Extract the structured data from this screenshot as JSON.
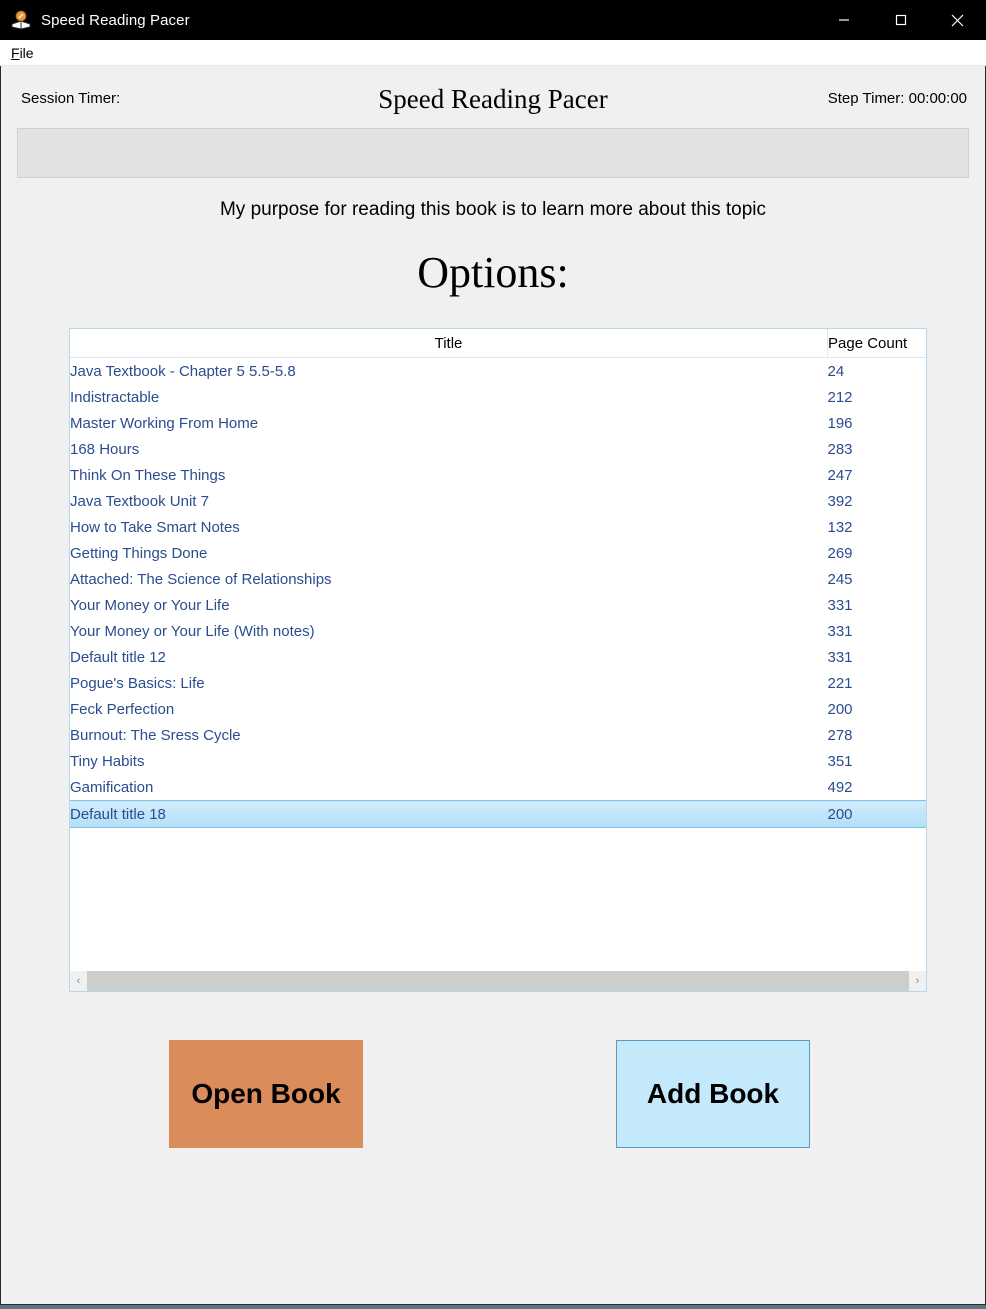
{
  "window": {
    "title": "Speed Reading Pacer",
    "icon": "book-icon",
    "controls": {
      "minimize": "minimize-icon",
      "maximize": "maximize-icon",
      "close": "close-icon"
    }
  },
  "menubar": {
    "items": [
      {
        "label": "File",
        "mnemonic": "F",
        "rest": "ile"
      }
    ]
  },
  "header": {
    "session_timer": "Session Timer:",
    "app_heading": "Speed Reading Pacer",
    "step_timer": "Step Timer: 00:00:00"
  },
  "display_panel": {
    "text": ""
  },
  "purpose": {
    "text": "My purpose for reading this book is to learn more about this topic"
  },
  "options": {
    "heading": "Options:"
  },
  "book_table": {
    "columns": [
      "Title",
      "Page Count"
    ],
    "selected_index": 17,
    "rows": [
      {
        "title": "Java Textbook - Chapter 5  5.5-5.8",
        "pages": "24"
      },
      {
        "title": "Indistractable",
        "pages": "212"
      },
      {
        "title": "Master Working From Home",
        "pages": "196"
      },
      {
        "title": "168 Hours",
        "pages": "283"
      },
      {
        "title": "Think On These Things",
        "pages": "247"
      },
      {
        "title": "Java Textbook Unit 7",
        "pages": "392"
      },
      {
        "title": "How to Take Smart Notes",
        "pages": "132"
      },
      {
        "title": "Getting Things Done",
        "pages": "269"
      },
      {
        "title": "Attached: The Science of Relationships",
        "pages": "245"
      },
      {
        "title": "Your Money or Your Life",
        "pages": "331"
      },
      {
        "title": "Your Money or Your Life (With notes)",
        "pages": "331"
      },
      {
        "title": "Default title 12",
        "pages": "331"
      },
      {
        "title": "Pogue's Basics: Life",
        "pages": "221"
      },
      {
        "title": "Feck Perfection",
        "pages": "200"
      },
      {
        "title": "Burnout: The Sress Cycle",
        "pages": "278"
      },
      {
        "title": "Tiny Habits",
        "pages": "351"
      },
      {
        "title": "Gamification",
        "pages": "492"
      },
      {
        "title": "Default title 18",
        "pages": "200"
      }
    ],
    "scrollbar": {
      "left_arrow": "chevron-left-icon",
      "right_arrow": "chevron-right-icon"
    }
  },
  "actions": {
    "open_book": "Open Book",
    "add_book": "Add Book"
  },
  "colors": {
    "open_book_bg": "#da8d5b",
    "add_book_bg": "#c4e9fb",
    "add_book_border": "#5b9bc0",
    "row_text": "#2a4d8f",
    "selection_bg": "#bfe5fa",
    "titlebar_bg": "#000000",
    "client_bg": "#f0f0f0",
    "panel_bg": "#e2e2e2"
  }
}
